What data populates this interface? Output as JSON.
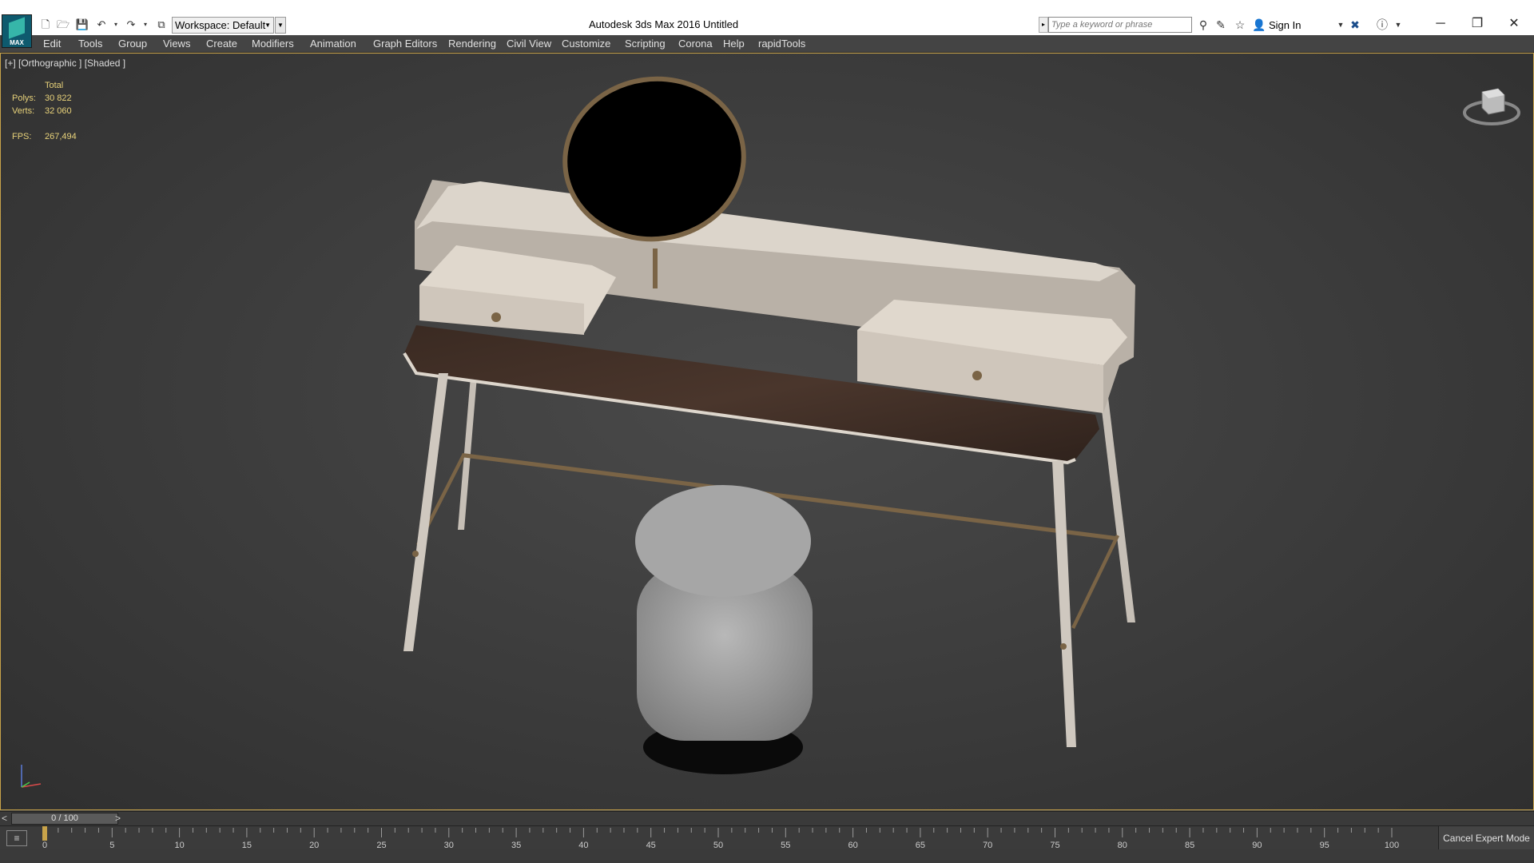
{
  "titlebar": {
    "workspace_label": "Workspace: Default",
    "app_title": "Autodesk 3ds Max 2016",
    "document_title": "Untitled",
    "search_placeholder": "Type a keyword or phrase",
    "sign_in_label": "Sign In",
    "logo_text": "MAX"
  },
  "menu": {
    "items": [
      "Edit",
      "Tools",
      "Group",
      "Views",
      "Create",
      "Modifiers",
      "Animation",
      "Graph Editors",
      "Rendering",
      "Civil View",
      "Customize",
      "Scripting",
      "Corona",
      "Help",
      "rapidTools"
    ]
  },
  "viewport": {
    "label": "[+] [Orthographic ] [Shaded ]",
    "stats": {
      "header": "Total",
      "polys_label": "Polys:",
      "polys_value": "30 822",
      "verts_label": "Verts:",
      "verts_value": "32 060",
      "fps_label": "FPS:",
      "fps_value": "267,494"
    },
    "scene_objects": [
      "vanity-desk",
      "round-mirror",
      "upholstered-pouf"
    ]
  },
  "timeline": {
    "slider_text": "0 / 100",
    "prev": "<",
    "next": ">",
    "ticks": [
      "0",
      "5",
      "10",
      "15",
      "20",
      "25",
      "30",
      "35",
      "40",
      "45",
      "50",
      "55",
      "60",
      "65",
      "70",
      "75",
      "80",
      "85",
      "90",
      "95",
      "100"
    ]
  },
  "expert_mode_label": "Cancel Expert Mode",
  "colors": {
    "viewport_border": "#c8a34a",
    "stats_text": "#e8d27a",
    "menu_bg": "#444444"
  }
}
